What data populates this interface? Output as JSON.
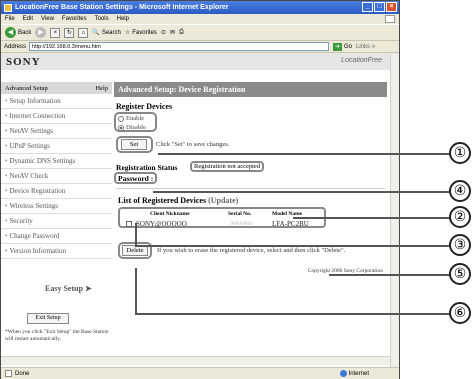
{
  "window": {
    "title": "LocationFree Base Station Settings - Microsoft Internet Explorer",
    "controls": [
      "_",
      "□",
      "×"
    ]
  },
  "menu": [
    "File",
    "Edit",
    "View",
    "Favorites",
    "Tools",
    "Help"
  ],
  "toolbar": {
    "back": "Back",
    "search": "Search",
    "favorites": "Favorites"
  },
  "address": {
    "label": "Address",
    "url": "http://192.168.0.3/menu.htm",
    "go": "Go",
    "links": "Links »"
  },
  "brand": {
    "sony": "SONY",
    "locationfree": "LocationFree"
  },
  "sidebar": {
    "header": "Advanced Setup",
    "help": "Help",
    "items": [
      "Setup Information",
      "Internet Connection",
      "NetAV Settings",
      "UPnP Settings",
      "Dynamic DNS Settings",
      "NetAV Check",
      "Device Registration",
      "Wireless Settings",
      "Security",
      "Change Password",
      "Version Information"
    ],
    "easy_setup": "Easy Setup",
    "exit_button": "Exit Setup",
    "exit_note": "*When you click \"Exit Setup\" the Base Station will restart automatically."
  },
  "main": {
    "header": "Advanced Setup: Device Registration",
    "register_devices_title": "Register Devices",
    "radio_options": [
      {
        "label": "Enable",
        "checked": false
      },
      {
        "label": "Disable",
        "checked": true
      }
    ],
    "set_button": "Set",
    "set_hint": "Click \"Set\" to save changes.",
    "status_label": "Registration Status",
    "status_value": "Registration not accepted",
    "password_label": "Password :",
    "list_title": "List of Registered Devices",
    "update_link": "(Update)",
    "table": {
      "headers": [
        "Client Nickname",
        "Serial No.",
        "Model Name"
      ],
      "rows": [
        {
          "nickname": "SONY@OOOOO",
          "serial": "00000000",
          "model": "LFA-PC2BU"
        }
      ]
    },
    "delete_button": "Delete",
    "delete_hint": "If you wish to erase the registered device, select and then click \"Delete\".",
    "copyright": "Copyright 2006 Sony Corporation"
  },
  "statusbar": {
    "left": "Done",
    "zone": "Internet"
  },
  "callouts": [
    "①",
    "②",
    "③",
    "④",
    "⑤",
    "⑥"
  ]
}
